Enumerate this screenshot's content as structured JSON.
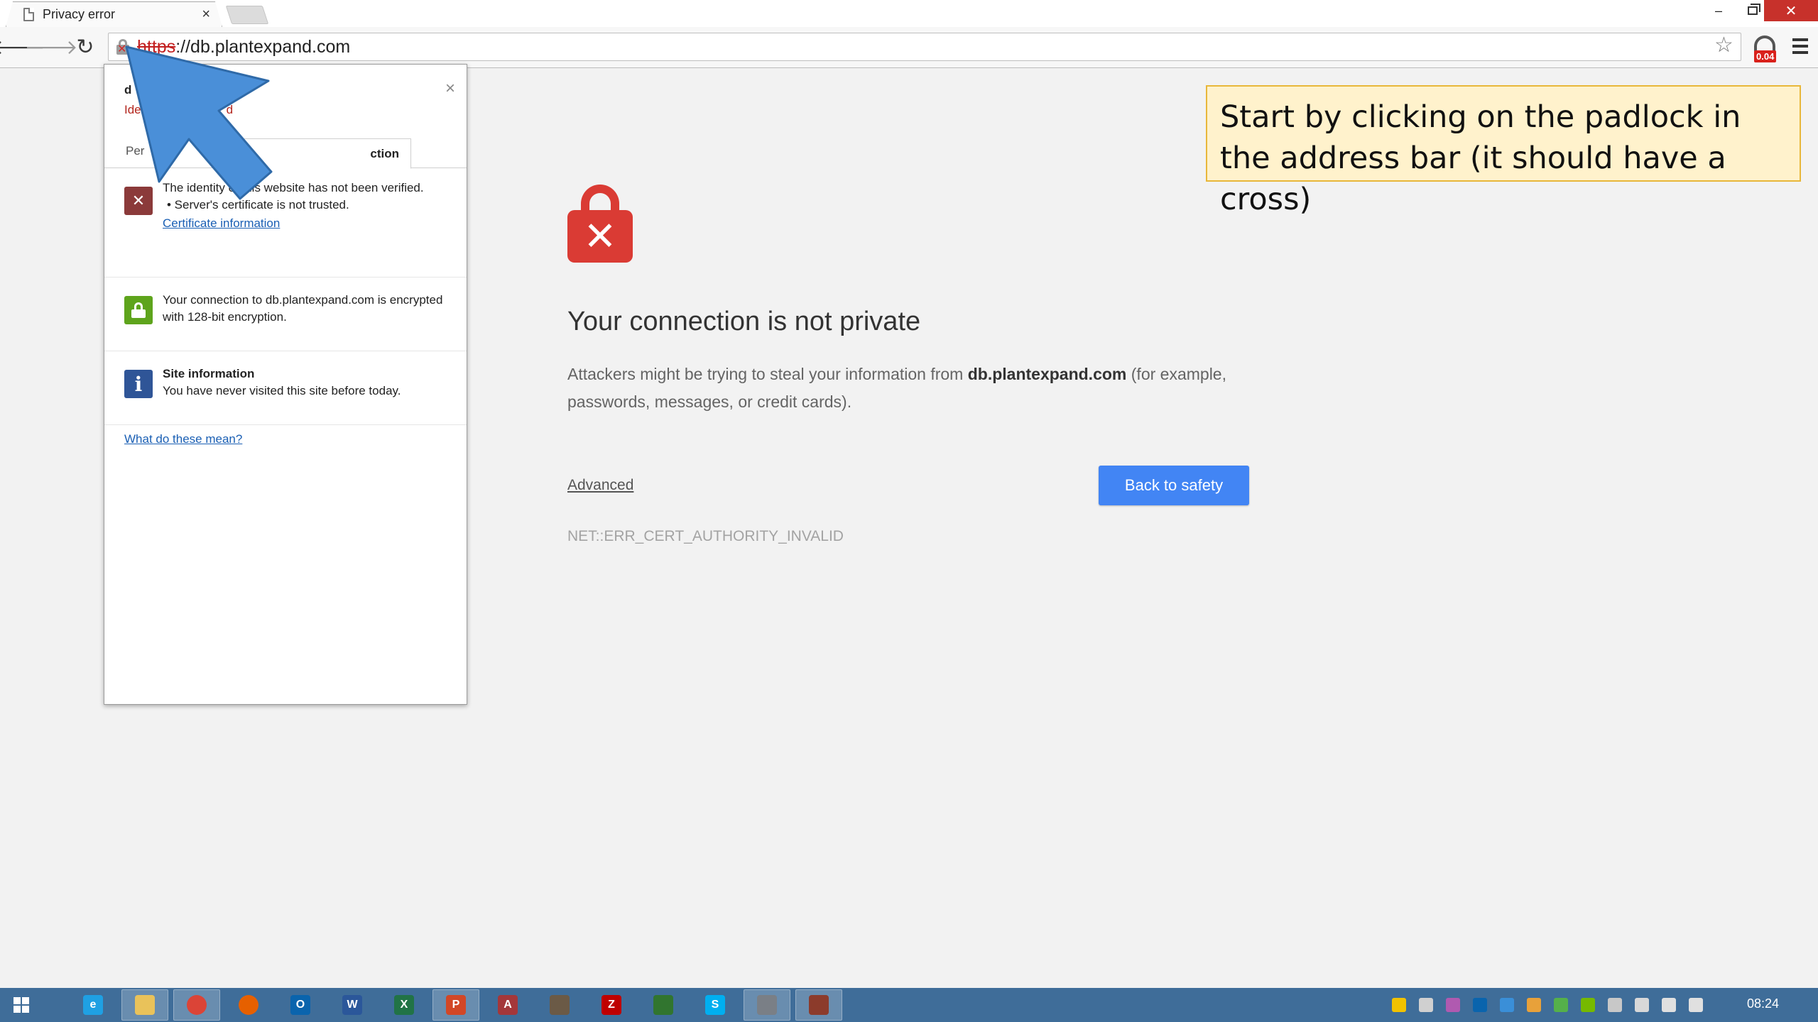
{
  "browser": {
    "tab_title": "Privacy error",
    "tab_close": "×",
    "url_scheme": "https",
    "url_rest": "://db.plantexpand.com",
    "star_icon": "☆",
    "extension_badge": "0.04"
  },
  "window_controls": {
    "minimize": "–",
    "close": "✕"
  },
  "page": {
    "headline": "Your connection is not private",
    "desc_before": "Attackers might be trying to steal your information from ",
    "desc_host": "db.plantexpand.com",
    "desc_after": " (for example, passwords, messages, or credit cards).",
    "advanced_link": "Advanced",
    "back_button": "Back to safety",
    "error_code": "NET::ERR_CERT_AUTHORITY_INVALID"
  },
  "popup": {
    "host_fragment": "d",
    "identity_fragment_a": "Ide",
    "identity_fragment_b": "d",
    "tab_permissions": "Per",
    "tab_connection": "ction",
    "close": "×",
    "identity_text": "The identity of this website has not been verified.",
    "identity_bullet": "• Server's certificate is not trusted.",
    "certificate_link": "Certificate information",
    "connection_text": "Your connection to db.plantexpand.com is encrypted with 128-bit encryption.",
    "site_info_title": "Site information",
    "site_info_text": "You have never visited this site before today.",
    "help_link": "What do these mean?"
  },
  "callout": {
    "text": "Start by clicking on the padlock in the address bar (it should have a cross)"
  },
  "taskbar": {
    "apps": [
      {
        "name": "internet-explorer",
        "label": "e",
        "color": "#1fa0e3",
        "active": false
      },
      {
        "name": "file-explorer",
        "label": "",
        "color": "#e9c25a",
        "active": true
      },
      {
        "name": "chrome",
        "label": "",
        "color": "#db4437",
        "active": true
      },
      {
        "name": "firefox",
        "label": "",
        "color": "#e66000",
        "active": false
      },
      {
        "name": "outlook",
        "label": "O",
        "color": "#0a64ad",
        "active": false
      },
      {
        "name": "word",
        "label": "W",
        "color": "#2b579a",
        "active": false
      },
      {
        "name": "excel",
        "label": "X",
        "color": "#217346",
        "active": false
      },
      {
        "name": "powerpoint",
        "label": "P",
        "color": "#d24726",
        "active": true
      },
      {
        "name": "access",
        "label": "A",
        "color": "#a4373a",
        "active": false
      },
      {
        "name": "gimp",
        "label": "",
        "color": "#6b5a46",
        "active": false
      },
      {
        "name": "filezilla",
        "label": "Z",
        "color": "#bf0000",
        "active": false
      },
      {
        "name": "project",
        "label": "",
        "color": "#31752f",
        "active": false
      },
      {
        "name": "skype",
        "label": "S",
        "color": "#00aff0",
        "active": false
      },
      {
        "name": "remote-app",
        "label": "",
        "color": "#7a7f86",
        "active": true
      },
      {
        "name": "presentation",
        "label": "",
        "color": "#8c3b2b",
        "active": true
      }
    ],
    "tray_colors": [
      "#f2c200",
      "#d0d0d0",
      "#b05ab0",
      "#0a64ad",
      "#3a8fd8",
      "#e8a13a",
      "#55b04a",
      "#76b900",
      "#c8c8c8",
      "#d8d8d8",
      "#e0e0e0",
      "#e0e0e0"
    ],
    "clock": "08:24"
  }
}
